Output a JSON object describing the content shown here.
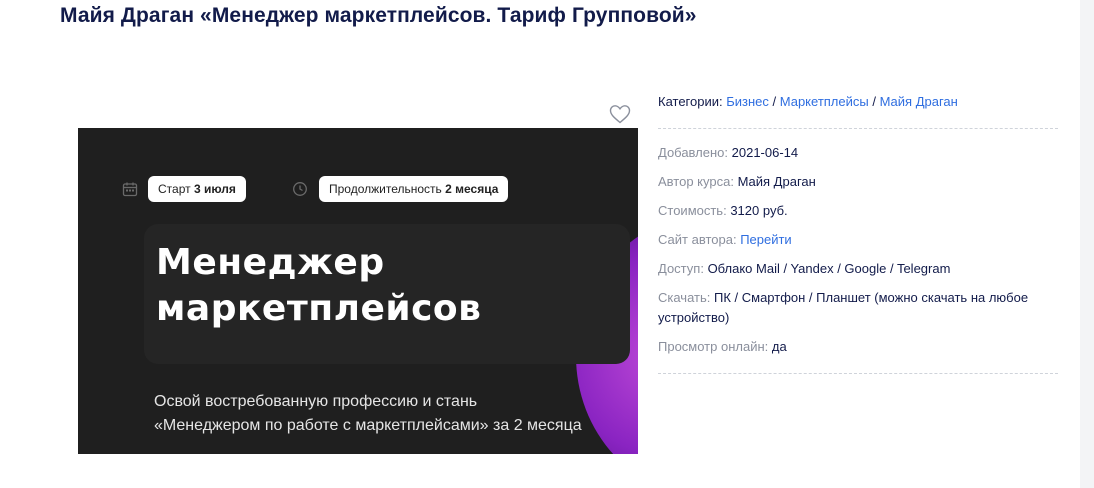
{
  "page": {
    "title": "Майя Драган «Менеджер маркетплейсов. Тариф Групповой»"
  },
  "banner": {
    "start_label": "Старт",
    "start_value": "3 июля",
    "duration_label": "Продолжительность",
    "duration_value": "2 месяца",
    "headline_line1": "Менеджер",
    "headline_line2": "маркетплейсов",
    "sub_line1": "Освой востребованную профессию и стань",
    "sub_line2": "«Менеджером по работе с маркетплейсами» за 2 месяца",
    "glow_color": "#8a24c2"
  },
  "info": {
    "categories_label": "Категории:",
    "categories": [
      "Бизнес",
      "Маркетплейсы",
      "Майя Драган"
    ],
    "separator": " / ",
    "added_label": "Добавлено:",
    "added_value": "2021-06-14",
    "author_label": "Автор курса:",
    "author_value": "Майя Драган",
    "price_label": "Стоимость:",
    "price_value": "3120 руб.",
    "site_label": "Сайт автора:",
    "site_value": "Перейти",
    "access_label": "Доступ:",
    "access_value": "Облако Mail / Yandex / Google / Telegram",
    "download_label": "Скачать:",
    "download_value": "ПК / Смартфон / Планшет (можно скачать на любое устройство)",
    "online_label": "Просмотр онлайн:",
    "online_value": "да"
  },
  "icons": {
    "favorite": "heart-outline-icon",
    "calendar": "calendar-icon",
    "clock": "clock-icon"
  },
  "colors": {
    "title": "#121b4a",
    "link": "#2f6ee0",
    "muted": "#8a8f9c"
  }
}
